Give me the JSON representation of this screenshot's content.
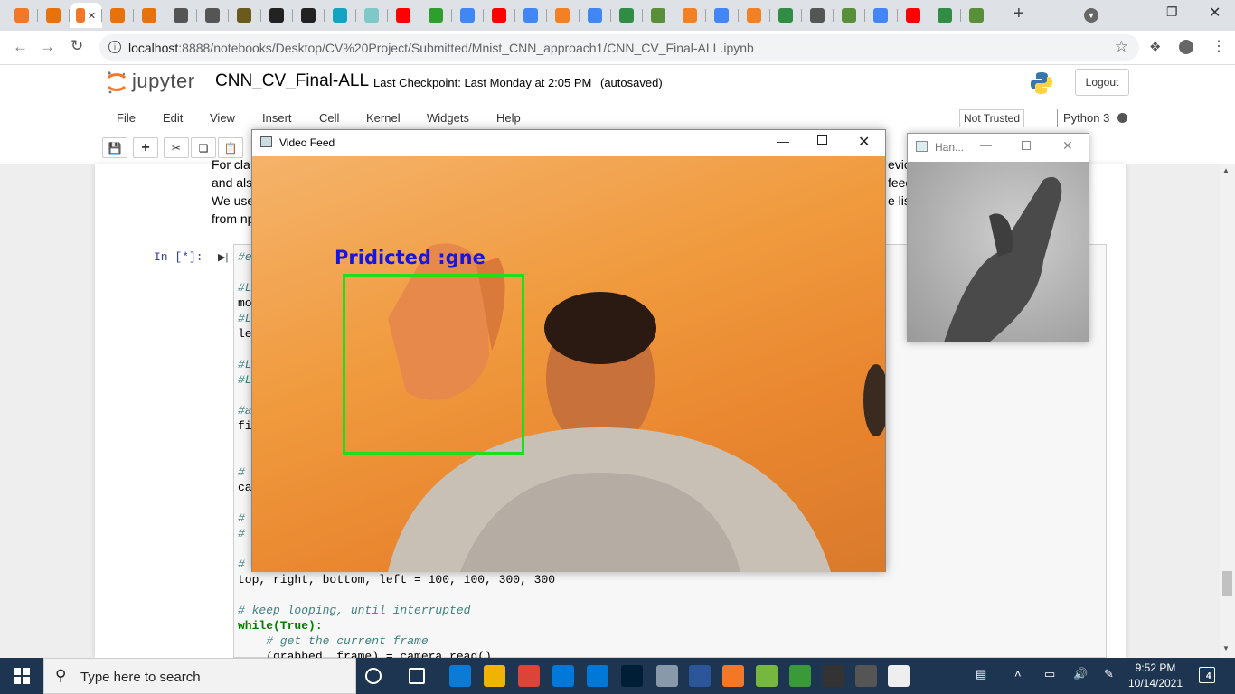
{
  "browser": {
    "tabs": [
      {
        "icon": "jupyter-icon",
        "color": "#f37726"
      },
      {
        "icon": "book-icon",
        "color": "#e8710a"
      },
      {
        "icon": "jupyter-icon",
        "color": "#f37726",
        "active": true
      },
      {
        "icon": "book-icon",
        "color": "#e8710a"
      },
      {
        "icon": "book-icon",
        "color": "#e8710a"
      },
      {
        "icon": "feather-icon",
        "color": "#555555"
      },
      {
        "icon": "feather-icon",
        "color": "#555555"
      },
      {
        "icon": "game-icon",
        "color": "#6b5a1e"
      },
      {
        "icon": "y-icon",
        "color": "#222222"
      },
      {
        "icon": "y-icon",
        "color": "#222222"
      },
      {
        "icon": "play-circle-icon",
        "color": "#13a4c2"
      },
      {
        "icon": "s-icon",
        "color": "#7ec8c8"
      },
      {
        "icon": "youtube-icon",
        "color": "#ff0000"
      },
      {
        "icon": "download-icon",
        "color": "#2e9e2e"
      },
      {
        "icon": "google-icon",
        "color": "#4285f4"
      },
      {
        "icon": "youtube-icon",
        "color": "#ff0000"
      },
      {
        "icon": "google-icon",
        "color": "#4285f4"
      },
      {
        "icon": "stackoverflow-icon",
        "color": "#f48024"
      },
      {
        "icon": "google-icon",
        "color": "#4285f4"
      },
      {
        "icon": "geeks-icon",
        "color": "#2f8d46"
      },
      {
        "icon": "puzzle-icon",
        "color": "#5a8f3a"
      },
      {
        "icon": "stackoverflow-icon",
        "color": "#f48024"
      },
      {
        "icon": "google-icon",
        "color": "#4285f4"
      },
      {
        "icon": "stackoverflow-icon",
        "color": "#f48024"
      },
      {
        "icon": "geeks-icon",
        "color": "#2f8d46"
      },
      {
        "icon": "globe-icon",
        "color": "#555555"
      },
      {
        "icon": "puzzle-icon",
        "color": "#5a8f3a"
      },
      {
        "icon": "google-icon",
        "color": "#4285f4"
      },
      {
        "icon": "youtube-icon",
        "color": "#ff0000"
      },
      {
        "icon": "geeks-icon",
        "color": "#2f8d46"
      },
      {
        "icon": "puzzle-icon",
        "color": "#5a8f3a"
      }
    ],
    "url_host": "localhost",
    "url_path": ":8888/notebooks/Desktop/CV%20Project/Submitted/Mnist_CNN_approach1/CNN_CV_Final-ALL.ipynb"
  },
  "jupyter": {
    "logo_text": "jupyter",
    "notebook_title": "CNN_CV_Final-ALL",
    "checkpoint": "Last Checkpoint: Last Monday at 2:05 PM",
    "autosaved": "(autosaved)",
    "logout": "Logout",
    "menu": [
      "File",
      "Edit",
      "View",
      "Insert",
      "Cell",
      "Kernel",
      "Widgets",
      "Help"
    ],
    "not_trusted": "Not Trusted",
    "kernel": "Python 3"
  },
  "notebook": {
    "markdown_lines": [
      "For cla",
      "and als",
      "We use",
      "from np"
    ],
    "markdown_right": [
      "evic",
      "feed",
      "e list"
    ],
    "prompt": "In [*]:",
    "code_lines": [
      {
        "text": "#e",
        "cls": "cm"
      },
      {
        "text": "#L",
        "cls": "cm"
      },
      {
        "text": "mo",
        "cls": ""
      },
      {
        "text": "#L",
        "cls": "cm"
      },
      {
        "text": "le",
        "cls": ""
      },
      {
        "text": "#L",
        "cls": "cm"
      },
      {
        "text": "#L",
        "cls": "cm"
      },
      {
        "text": "#a",
        "cls": "cm"
      },
      {
        "text": "fi",
        "cls": ""
      },
      {
        "text": "#",
        "cls": "cm"
      },
      {
        "text": "ca",
        "cls": ""
      },
      {
        "text": "#",
        "cls": "cm"
      },
      {
        "text": "#",
        "cls": "cm"
      },
      {
        "text": "#",
        "cls": "cm"
      }
    ],
    "code_roi": "top, right, bottom, left = 100, 100, 300, 300",
    "code_comment_loop": "# keep looping, until interrupted",
    "code_while": "while(True):",
    "code_comment_frame": "    # get the current frame",
    "code_grab": "    (grabbed, frame) = camera.read()"
  },
  "video_window": {
    "title": "Video Feed",
    "prediction": "Pridicted :gne"
  },
  "hand_window": {
    "title": "Han..."
  },
  "taskbar": {
    "search_placeholder": "Type here to search",
    "time": "9:52 PM",
    "date": "10/14/2021",
    "notification_count": "4",
    "apps": [
      {
        "icon": "cortana-icon",
        "color": "#1e3552"
      },
      {
        "icon": "task-view-icon",
        "color": "#1e3552"
      },
      {
        "icon": "edge-icon",
        "color": "#0c7bd6"
      },
      {
        "icon": "file-explorer-icon",
        "color": "#f0b400"
      },
      {
        "icon": "chrome-icon",
        "color": "#db4437"
      },
      {
        "icon": "store-icon",
        "color": "#0078d7"
      },
      {
        "icon": "mail-icon",
        "color": "#0078d7"
      },
      {
        "icon": "photoshop-icon",
        "color": "#001e36"
      },
      {
        "icon": "tool-icon",
        "color": "#8899aa"
      },
      {
        "icon": "word-icon",
        "color": "#2b579a"
      },
      {
        "icon": "jupyter-icon",
        "color": "#f37726"
      },
      {
        "icon": "utorrent-icon",
        "color": "#76b83f"
      },
      {
        "icon": "network-icon",
        "color": "#3a9a3a"
      },
      {
        "icon": "terminal-icon",
        "color": "#333333"
      },
      {
        "icon": "photos-icon",
        "color": "#555555"
      },
      {
        "icon": "document-icon",
        "color": "#eeeeee"
      }
    ]
  }
}
